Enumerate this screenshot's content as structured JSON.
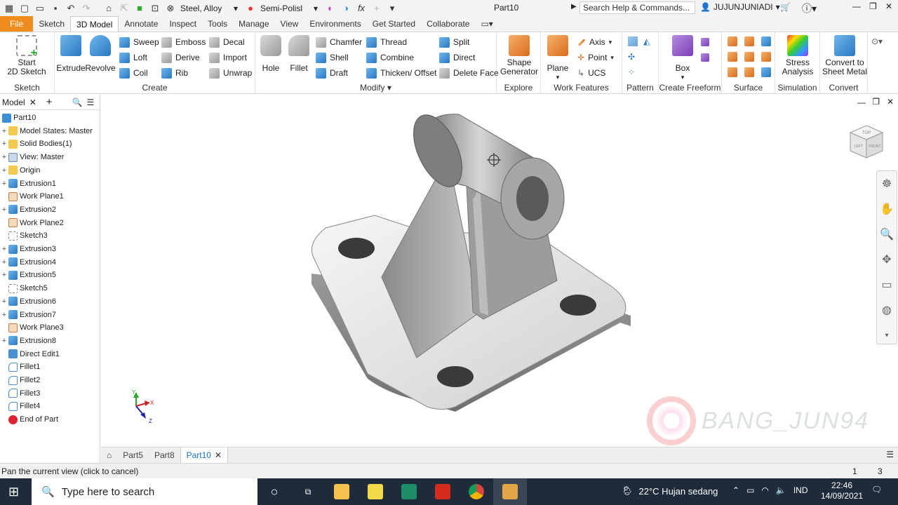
{
  "titlebar": {
    "material": "Steel, Alloy",
    "appearance": "Semi-Polisl",
    "document_title": "Part10",
    "search_placeholder": "Search Help & Commands...",
    "user": "JUJUNJUNIADI"
  },
  "tabs": [
    "File",
    "Sketch",
    "3D Model",
    "Annotate",
    "Inspect",
    "Tools",
    "Manage",
    "View",
    "Environments",
    "Get Started",
    "Collaborate"
  ],
  "active_tab": "3D Model",
  "ribbon": {
    "sketch": {
      "start_sketch": "Start\n2D Sketch",
      "label": "Sketch"
    },
    "create": {
      "extrude": "Extrude",
      "revolve": "Revolve",
      "sweep": "Sweep",
      "loft": "Loft",
      "coil": "Coil",
      "emboss": "Emboss",
      "derive": "Derive",
      "rib": "Rib",
      "decal": "Decal",
      "import": "Import",
      "unwrap": "Unwrap",
      "label": "Create"
    },
    "modify": {
      "hole": "Hole",
      "fillet": "Fillet",
      "chamfer": "Chamfer",
      "shell": "Shell",
      "draft": "Draft",
      "thread": "Thread",
      "combine": "Combine",
      "thicken": "Thicken/ Offset",
      "split": "Split",
      "direct": "Direct",
      "delete_face": "Delete Face",
      "label": "Modify"
    },
    "explore": {
      "shape_generator": "Shape\nGenerator",
      "label": "Explore"
    },
    "work_features": {
      "plane": "Plane",
      "axis": "Axis",
      "point": "Point",
      "ucs": "UCS",
      "label": "Work Features"
    },
    "pattern": {
      "label": "Pattern"
    },
    "freeform": {
      "box": "Box",
      "label": "Create Freeform"
    },
    "surface": {
      "label": "Surface"
    },
    "simulation": {
      "stress": "Stress\nAnalysis",
      "label": "Simulation"
    },
    "convert": {
      "sheet_metal": "Convert to\nSheet Metal",
      "label": "Convert"
    }
  },
  "browser": {
    "tab": "Model",
    "items": [
      {
        "label": "Part10",
        "icon": "part-icon",
        "expand": false
      },
      {
        "label": "Model States: Master",
        "icon": "folder-icon",
        "expand": true
      },
      {
        "label": "Solid Bodies(1)",
        "icon": "folder-icon",
        "expand": true
      },
      {
        "label": "View: Master",
        "icon": "view-icon",
        "expand": true
      },
      {
        "label": "Origin",
        "icon": "folder-icon",
        "expand": true
      },
      {
        "label": "Extrusion1",
        "icon": "extrusion-icon",
        "expand": true
      },
      {
        "label": "Work Plane1",
        "icon": "workplane-icon",
        "expand": false
      },
      {
        "label": "Extrusion2",
        "icon": "extrusion-icon",
        "expand": true
      },
      {
        "label": "Work Plane2",
        "icon": "workplane-icon",
        "expand": false
      },
      {
        "label": "Sketch3",
        "icon": "sketch-icon",
        "expand": false
      },
      {
        "label": "Extrusion3",
        "icon": "extrusion-icon",
        "expand": true
      },
      {
        "label": "Extrusion4",
        "icon": "extrusion-icon",
        "expand": true
      },
      {
        "label": "Extrusion5",
        "icon": "extrusion-icon",
        "expand": true
      },
      {
        "label": "Sketch5",
        "icon": "sketch-icon",
        "expand": false
      },
      {
        "label": "Extrusion6",
        "icon": "extrusion-icon",
        "expand": true
      },
      {
        "label": "Extrusion7",
        "icon": "extrusion-icon",
        "expand": true
      },
      {
        "label": "Work Plane3",
        "icon": "workplane-icon",
        "expand": false
      },
      {
        "label": "Extrusion8",
        "icon": "extrusion-icon",
        "expand": true
      },
      {
        "label": "Direct Edit1",
        "icon": "direct-edit-icon",
        "expand": false
      },
      {
        "label": "Fillet1",
        "icon": "fillet-icon",
        "expand": false
      },
      {
        "label": "Fillet2",
        "icon": "fillet-icon",
        "expand": false
      },
      {
        "label": "Fillet3",
        "icon": "fillet-icon",
        "expand": false
      },
      {
        "label": "Fillet4",
        "icon": "fillet-icon",
        "expand": false
      },
      {
        "label": "End of Part",
        "icon": "end-of-part-icon",
        "expand": false
      }
    ]
  },
  "doc_tabs": [
    "Part5",
    "Part8",
    "Part10"
  ],
  "active_doc": "Part10",
  "status": {
    "message": "Pan the current view (click to cancel)",
    "n1": "1",
    "n2": "3"
  },
  "watermark": "BANG_JUN94",
  "viewcube": {
    "top": "TOP",
    "front": "FRONT",
    "left": "LEFT"
  },
  "triad": {
    "x": "X",
    "y": "Y",
    "z": "Z"
  },
  "taskbar": {
    "search_placeholder": "Type here to search",
    "weather": "22°C  Hujan sedang",
    "lang": "IND",
    "time": "22:46",
    "date": "14/09/2021"
  }
}
